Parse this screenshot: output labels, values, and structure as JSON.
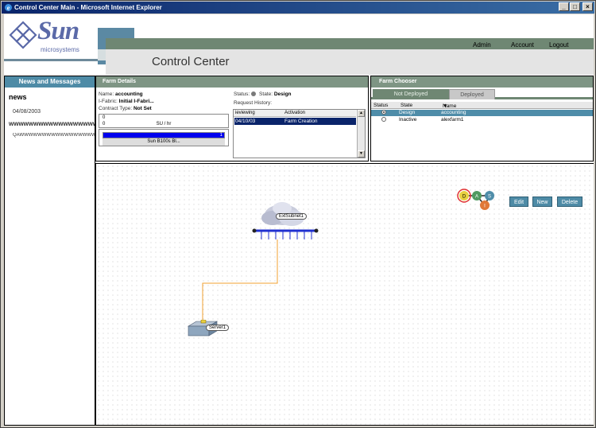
{
  "window": {
    "title": "Control Center Main - Microsoft Internet Explorer",
    "buttons": {
      "minimize": "_",
      "maximize": "□",
      "close": "×"
    }
  },
  "header": {
    "logo_word": "Sun",
    "logo_sub": "microsystems",
    "links": [
      "Admin",
      "Account",
      "Logout"
    ],
    "title": "Control Center"
  },
  "news": {
    "panel_title": "News and Messages",
    "heading": "news",
    "date": "04/08/2003",
    "item_title": "wwwwwwwwwwwwwwwwwwwwwwwwwwwwwwwww",
    "item_body": "QAWWWWWWWWWWWWWWWWWWWWWWW"
  },
  "farm_details": {
    "panel_title": "Farm Details",
    "name_label": "Name:",
    "name_value": "accounting",
    "ifabric_label": "I-Fabric:",
    "ifabric_value": "Initial I-Fabri...",
    "contract_label": "Contract Type:",
    "contract_value": "Not Set",
    "su_top": "0",
    "su_left": "0",
    "su_unit": "SU / hr",
    "progress_label": "1",
    "progress_fraction": 1.0,
    "blade": "Sun B100s Bl...",
    "status_label": "Status:",
    "state_label": "State:",
    "state_value": "Design",
    "history_label": "Request History:",
    "history_cols": [
      "ieviewing",
      "Activation"
    ],
    "history_rows": [
      {
        "date": "04/10/03",
        "activity": "Farm Creation"
      }
    ]
  },
  "farm_chooser": {
    "panel_title": "Farm Chooser",
    "tabs": [
      "Not Deployed",
      "Deployed"
    ],
    "columns": [
      "Status",
      "State",
      "Name"
    ],
    "rows": [
      {
        "state": "Design",
        "name": "accounting",
        "selected": true
      },
      {
        "state": "Inactive",
        "name": "alexfarm1",
        "selected": false
      }
    ]
  },
  "canvas": {
    "toolbar": [
      "Edit",
      "New",
      "Delete"
    ],
    "legend": [
      "D",
      "A",
      "S",
      "I"
    ],
    "subnet_label": "ExtSubnet1",
    "server_label": "Server1"
  },
  "colors": {
    "news_header": "#4e8ba6",
    "panel_header": "#7e9584",
    "selection": "#0a246a",
    "chooser_selection": "#4f8da9",
    "button": "#4e8ba6",
    "wire": "#f0a030",
    "subnet_bar": "#2030d0"
  }
}
